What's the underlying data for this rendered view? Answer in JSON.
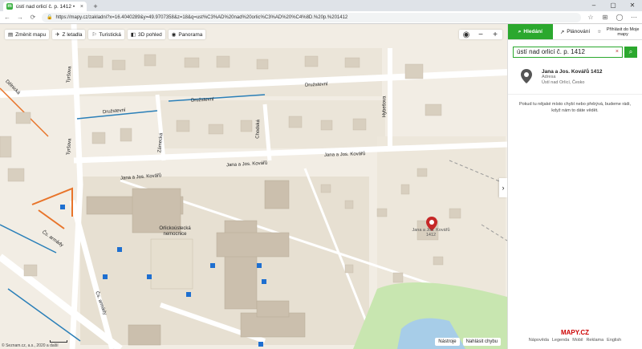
{
  "browser": {
    "tab_title": "ústí nad orlicí č. p. 1412 •",
    "tab_close": "×",
    "new_tab": "+",
    "url": "https://mapy.cz/zakladni?x=16.4040289&y=49.9707358&z=18&q=ust%C3%AD%20nad%20orlic%C3%AD%20%C4%8D.%20p.%201412",
    "window_controls": [
      "–",
      "▢",
      "✕"
    ],
    "nav": [
      "←",
      "→",
      "⟳"
    ]
  },
  "map_tools": [
    {
      "label": "Změnit mapu",
      "icon": "layers-icon"
    },
    {
      "label": "Z letadla",
      "icon": "plane-icon"
    },
    {
      "label": "Turistická",
      "icon": "hiker-icon"
    },
    {
      "label": "3D pohled",
      "icon": "cube-icon"
    },
    {
      "label": "Panorama",
      "icon": "eye-icon"
    }
  ],
  "zoom": {
    "locate": "◉",
    "minus": "−",
    "plus": "+"
  },
  "streets": [
    "Družstevní",
    "Družstevní",
    "Družstevní",
    "Jana a Jos. Kovářů",
    "Jana a Jos. Kovářů",
    "Jana a Jos. Kovářů",
    "Čs. armády",
    "Čs. armády",
    "Chodská",
    "Zámecká",
    "Tyršova",
    "Hybešova",
    "Tyršova",
    "Dělnická"
  ],
  "labels": {
    "hospital": "Orlickoústecká nemocnice",
    "poi": "Jana a Jos. Kovářů 1412"
  },
  "map_bottom": {
    "tools": "Nástroje",
    "report": "Nahlásit chybu"
  },
  "copyright": "© Seznam.cz, a.s., 2020 a další",
  "panel": {
    "tabs": {
      "search": "Hledání",
      "plan": "Plánování",
      "login": "Přihlásit do Moje mapy"
    },
    "search_value": "ústí nad orlicí č. p. 1412",
    "search_clear": "×",
    "result": {
      "name": "Jana a Jos. Kovářů 1412",
      "type": "Adresa",
      "place": "Ústí nad Orlicí, Česko"
    },
    "feedback": "Pokud tu nějaké místo chybí nebo přebývá, budeme rádi, když nám to dáte vědět.",
    "footer_logo": "MAPY.CZ",
    "footer_links": [
      "Nápověda",
      "Legenda",
      "Mobil",
      "Reklama",
      "English"
    ]
  },
  "colors": {
    "accent": "#2ba82e",
    "road_blue": "#2a7fb8",
    "road_orange": "#e8742a",
    "pin": "#c62828"
  }
}
